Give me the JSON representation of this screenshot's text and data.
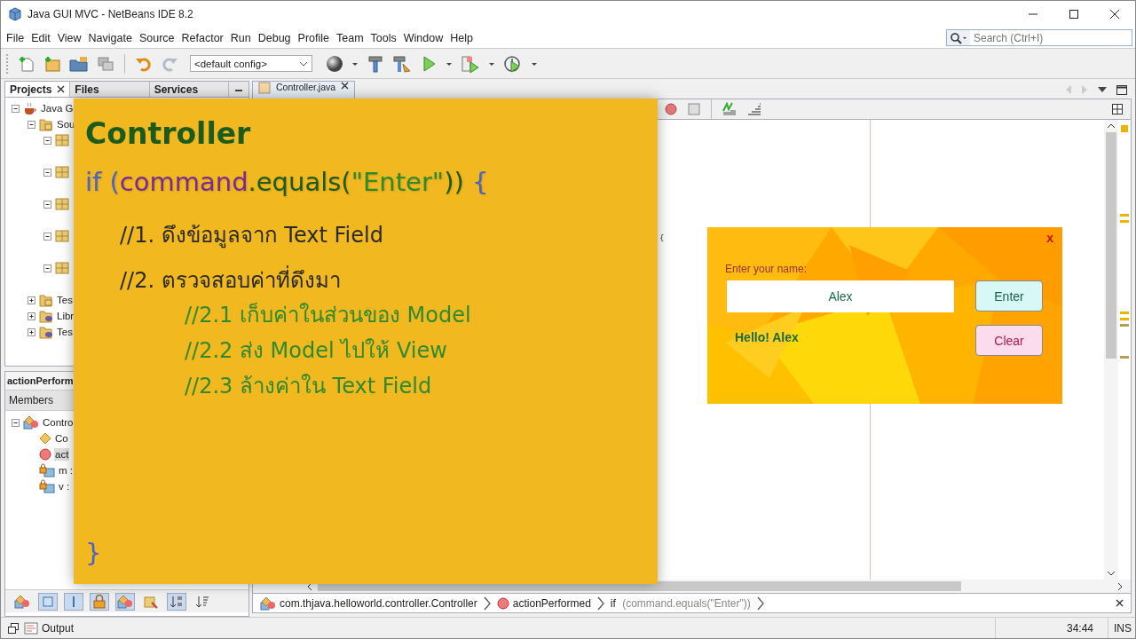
{
  "window": {
    "title": "Java GUI MVC - NetBeans IDE 8.2"
  },
  "menu": [
    "File",
    "Edit",
    "View",
    "Navigate",
    "Source",
    "Refactor",
    "Run",
    "Debug",
    "Profile",
    "Team",
    "Tools",
    "Window",
    "Help"
  ],
  "search": {
    "placeholder": "Search (Ctrl+I)"
  },
  "toolbar": {
    "config": "<default config>"
  },
  "projects_panel": {
    "tabs": [
      {
        "label": "Projects",
        "selected": true
      },
      {
        "label": "Files",
        "selected": false
      },
      {
        "label": "Services",
        "selected": false
      }
    ],
    "tree": [
      {
        "label": "Java G",
        "kind": "project",
        "expanded": true,
        "children": [
          {
            "label": "Sou",
            "kind": "source",
            "expanded": true,
            "children": [
              {
                "kind": "package",
                "expanded": true
              },
              {
                "kind": "package",
                "expanded": true
              },
              {
                "kind": "package",
                "expanded": true
              },
              {
                "kind": "package",
                "expanded": true
              },
              {
                "kind": "package",
                "expanded": true
              }
            ]
          },
          {
            "label": "Tes",
            "kind": "source",
            "expanded": false
          },
          {
            "label": "Libr",
            "kind": "library",
            "expanded": false
          },
          {
            "label": "Tes",
            "kind": "library",
            "expanded": false
          }
        ]
      }
    ]
  },
  "navigator": {
    "title": "actionPerform",
    "header": "Members",
    "tree": [
      {
        "label": "Contro",
        "kind": "class",
        "expanded": true,
        "selected": false,
        "children": [
          {
            "label": "Co",
            "kind": "constructor",
            "selected": false
          },
          {
            "label": "act",
            "kind": "method",
            "selected": true
          },
          {
            "label": "m :",
            "kind": "field",
            "selected": false
          },
          {
            "label": "v :",
            "kind": "field",
            "selected": false
          }
        ]
      }
    ]
  },
  "editor": {
    "tab": "Controller.java",
    "brace": "{"
  },
  "slide": {
    "title": "Controller",
    "code": [
      {
        "text": "if (",
        "color": "#4b63c6"
      },
      {
        "text": "command",
        "color": "#7a2a92"
      },
      {
        "text": ".equals(",
        "color": "#1d5a1d"
      },
      {
        "text": "\"Enter\"",
        "color": "#2f8a2f"
      },
      {
        "text": "))",
        "color": "#1d5a1d"
      },
      {
        "text": " {",
        "color": "#4b63c6"
      }
    ],
    "comments": [
      {
        "text": "//1. ดึงข้อมูลจาก Text Field"
      },
      {
        "text": "//2. ตรวจสอบค่าที่ดึงมา",
        "children": [
          {
            "text": "//2.1 เก็บค่าในส่วนของ Model"
          },
          {
            "text": "//2.2 ส่ง Model ไปให้ View"
          },
          {
            "text": "//2.3 ล้างค่าใน Text Field"
          }
        ]
      }
    ],
    "closing": "}"
  },
  "app": {
    "close": "x",
    "label": "Enter your name:",
    "value": "Alex",
    "greeting": "Hello! Alex",
    "buttons": [
      {
        "label": "Enter",
        "kind": "enter"
      },
      {
        "label": "Clear",
        "kind": "clear"
      }
    ]
  },
  "breadcrumb": [
    {
      "kind": "class",
      "text": "com.thjava.helloworld.controller.Controller"
    },
    {
      "kind": "method",
      "text": "actionPerformed"
    },
    {
      "kind": "statement",
      "keyword": "if",
      "text": "(command.equals(\"Enter\"))"
    }
  ],
  "status_bar": {
    "output": "Output",
    "position": "34:44",
    "mode": "INS"
  }
}
